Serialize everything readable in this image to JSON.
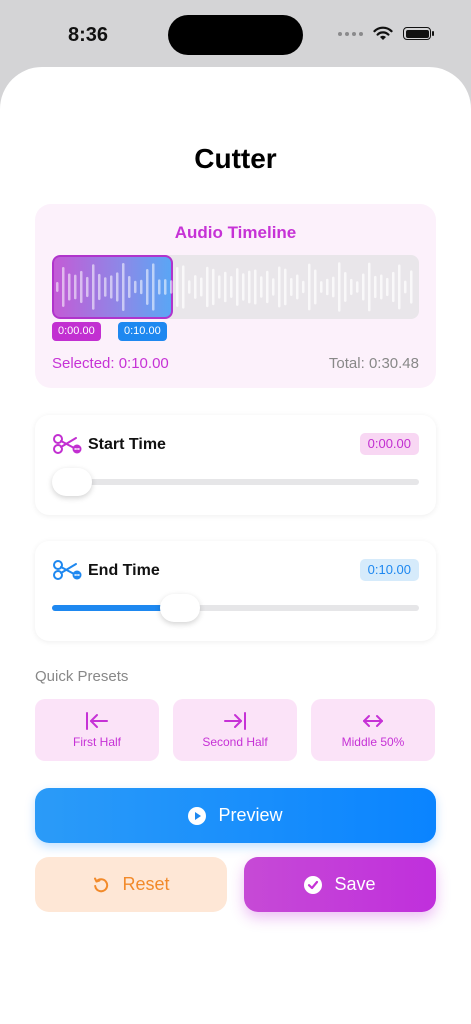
{
  "status": {
    "time": "8:36"
  },
  "title": "Cutter",
  "timeline": {
    "title": "Audio Timeline",
    "start_tag": "0:00.00",
    "end_tag": "0:10.00",
    "selected": "Selected: 0:10.00",
    "total": "Total: 0:30.48",
    "selection_fraction": 0.33
  },
  "start_slider": {
    "label": "Start Time",
    "value": "0:00.00",
    "fraction": 0.0
  },
  "end_slider": {
    "label": "End Time",
    "value": "0:10.00",
    "fraction": 0.33
  },
  "presets": {
    "label": "Quick Presets",
    "items": [
      {
        "label": "First Half",
        "icon": "arrow-left-to-bar-icon"
      },
      {
        "label": "Second Half",
        "icon": "arrow-right-to-bar-icon"
      },
      {
        "label": "Middle 50%",
        "icon": "arrows-left-right-icon"
      }
    ]
  },
  "buttons": {
    "preview": "Preview",
    "reset": "Reset",
    "save": "Save"
  },
  "colors": {
    "accent_purple": "#c632d6",
    "accent_blue": "#1e88f0",
    "reset_orange": "#f28a2a"
  }
}
